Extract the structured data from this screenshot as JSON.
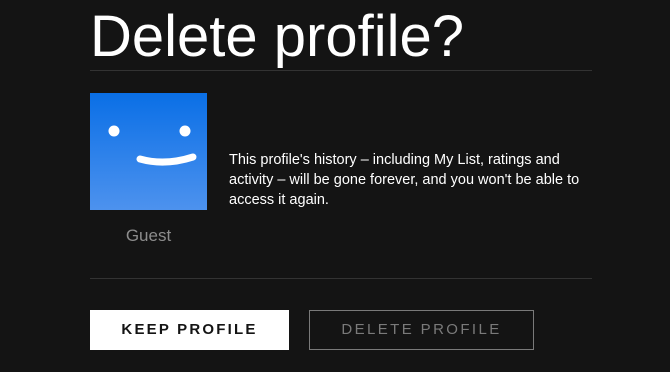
{
  "dialog": {
    "title": "Delete profile?",
    "message": "This profile's history – including My List, ratings and activity – will be gone forever, and you won't be able to access it again."
  },
  "profile": {
    "name": "Guest",
    "avatar_icon": "smiley-face-icon",
    "avatar_colors": {
      "top": "#0a6fe6",
      "bottom": "#4d92ee"
    }
  },
  "actions": {
    "keep_label": "KEEP PROFILE",
    "delete_label": "DELETE PROFILE"
  },
  "colors": {
    "background": "#141414",
    "text": "#ffffff",
    "muted": "#8c8c8c",
    "divider": "#333333"
  }
}
